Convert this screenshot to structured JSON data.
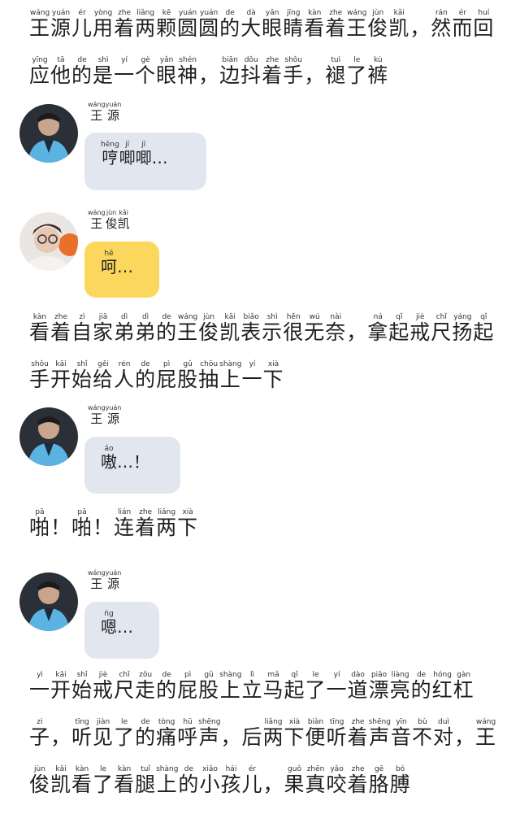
{
  "narration_1": [
    {
      "h": "王",
      "p": "wáng"
    },
    {
      "h": "源",
      "p": "yuán"
    },
    {
      "h": "儿",
      "p": "ér"
    },
    {
      "h": "用",
      "p": "yòng"
    },
    {
      "h": "着",
      "p": "zhe"
    },
    {
      "h": "两",
      "p": "liǎng"
    },
    {
      "h": "颗",
      "p": "kē"
    },
    {
      "h": "圆",
      "p": "yuán"
    },
    {
      "h": "圆",
      "p": "yuán"
    },
    {
      "h": "的",
      "p": "de"
    },
    {
      "h": "大",
      "p": "dà"
    },
    {
      "h": "眼",
      "p": "yǎn"
    },
    {
      "h": "睛",
      "p": "jīng"
    },
    {
      "h": "看",
      "p": "kàn"
    },
    {
      "h": "着",
      "p": "zhe"
    },
    {
      "h": "王",
      "p": "wáng"
    },
    {
      "h": "俊",
      "p": "jùn"
    },
    {
      "h": "凯",
      "p": "kǎi"
    },
    {
      "h": "，",
      "p": ""
    },
    {
      "h": "然",
      "p": "rán"
    },
    {
      "h": "而",
      "p": "ér"
    },
    {
      "h": "回",
      "p": "huí"
    },
    {
      "h": "应",
      "p": "yīng"
    },
    {
      "h": "他",
      "p": "tā"
    },
    {
      "h": "的",
      "p": "de"
    },
    {
      "h": "是",
      "p": "shì"
    },
    {
      "h": "一",
      "p": "yí"
    },
    {
      "h": "个",
      "p": "gè"
    },
    {
      "h": "眼",
      "p": "yǎn"
    },
    {
      "h": "神",
      "p": "shén"
    },
    {
      "h": "，",
      "p": ""
    },
    {
      "h": "边",
      "p": "biān"
    },
    {
      "h": "抖",
      "p": "dǒu"
    },
    {
      "h": "着",
      "p": "zhe"
    },
    {
      "h": "手",
      "p": "shǒu"
    },
    {
      "h": "，",
      "p": ""
    },
    {
      "h": "褪",
      "p": "tuì"
    },
    {
      "h": "了",
      "p": "le"
    },
    {
      "h": "裤",
      "p": "kù"
    }
  ],
  "msg_1": {
    "name": [
      {
        "h": "王",
        "p": "wáng"
      },
      {
        "h": "源",
        "p": "yuán"
      }
    ],
    "text": [
      {
        "h": "哼",
        "p": "hēng"
      },
      {
        "h": "唧",
        "p": "jī"
      },
      {
        "h": "唧",
        "p": "jī"
      },
      {
        "h": "…",
        "p": ""
      }
    ]
  },
  "msg_2": {
    "name": [
      {
        "h": "王",
        "p": "wáng"
      },
      {
        "h": "俊",
        "p": "jùn"
      },
      {
        "h": "凯",
        "p": "kǎi"
      }
    ],
    "text": [
      {
        "h": "呵",
        "p": "hē"
      },
      {
        "h": "…",
        "p": ""
      }
    ]
  },
  "narration_2": [
    {
      "h": "看",
      "p": "kàn"
    },
    {
      "h": "着",
      "p": "zhe"
    },
    {
      "h": "自",
      "p": "zì"
    },
    {
      "h": "家",
      "p": "jiā"
    },
    {
      "h": "弟",
      "p": "dì"
    },
    {
      "h": "弟",
      "p": "dì"
    },
    {
      "h": "的",
      "p": "de"
    },
    {
      "h": "王",
      "p": "wáng"
    },
    {
      "h": "俊",
      "p": "jùn"
    },
    {
      "h": "凯",
      "p": "kǎi"
    },
    {
      "h": "表",
      "p": "biǎo"
    },
    {
      "h": "示",
      "p": "shì"
    },
    {
      "h": "很",
      "p": "hěn"
    },
    {
      "h": "无",
      "p": "wú"
    },
    {
      "h": "奈",
      "p": "nài"
    },
    {
      "h": "，",
      "p": ""
    },
    {
      "h": "拿",
      "p": "ná"
    },
    {
      "h": "起",
      "p": "qǐ"
    },
    {
      "h": "戒",
      "p": "jiè"
    },
    {
      "h": "尺",
      "p": "chǐ"
    },
    {
      "h": "扬",
      "p": "yáng"
    },
    {
      "h": "起",
      "p": "qǐ"
    },
    {
      "h": "手",
      "p": "shǒu"
    },
    {
      "h": "开",
      "p": "kāi"
    },
    {
      "h": "始",
      "p": "shǐ"
    },
    {
      "h": "给",
      "p": "gěi"
    },
    {
      "h": "人",
      "p": "rén"
    },
    {
      "h": "的",
      "p": "de"
    },
    {
      "h": "屁",
      "p": "pì"
    },
    {
      "h": "股",
      "p": "gǔ"
    },
    {
      "h": "抽",
      "p": "chōu"
    },
    {
      "h": "上",
      "p": "shàng"
    },
    {
      "h": "一",
      "p": "yí"
    },
    {
      "h": "下",
      "p": "xià"
    }
  ],
  "msg_3": {
    "name": [
      {
        "h": "王",
        "p": "wáng"
      },
      {
        "h": "源",
        "p": "yuán"
      }
    ],
    "text": [
      {
        "h": "嗷",
        "p": "áo"
      },
      {
        "h": "…！",
        "p": ""
      }
    ]
  },
  "narration_3": [
    {
      "h": "啪",
      "p": "pā"
    },
    {
      "h": "！",
      "p": ""
    },
    {
      "h": "啪",
      "p": "pā"
    },
    {
      "h": "！",
      "p": ""
    },
    {
      "h": "连",
      "p": "lián"
    },
    {
      "h": "着",
      "p": "zhe"
    },
    {
      "h": "两",
      "p": "liǎng"
    },
    {
      "h": "下",
      "p": "xià"
    }
  ],
  "msg_4": {
    "name": [
      {
        "h": "王",
        "p": "wáng"
      },
      {
        "h": "源",
        "p": "yuán"
      }
    ],
    "text": [
      {
        "h": "嗯",
        "p": "ńg"
      },
      {
        "h": "…",
        "p": ""
      }
    ]
  },
  "narration_4": [
    {
      "h": "一",
      "p": "yì"
    },
    {
      "h": "开",
      "p": "kāi"
    },
    {
      "h": "始",
      "p": "shǐ"
    },
    {
      "h": "戒",
      "p": "jiè"
    },
    {
      "h": "尺",
      "p": "chǐ"
    },
    {
      "h": "走",
      "p": "zǒu"
    },
    {
      "h": "的",
      "p": "de"
    },
    {
      "h": "屁",
      "p": "pì"
    },
    {
      "h": "股",
      "p": "gǔ"
    },
    {
      "h": "上",
      "p": "shàng"
    },
    {
      "h": "立",
      "p": "lì"
    },
    {
      "h": "马",
      "p": "mǎ"
    },
    {
      "h": "起",
      "p": "qǐ"
    },
    {
      "h": "了",
      "p": "le"
    },
    {
      "h": "一",
      "p": "yí"
    },
    {
      "h": "道",
      "p": "dào"
    },
    {
      "h": "漂",
      "p": "piāo"
    },
    {
      "h": "亮",
      "p": "liàng"
    },
    {
      "h": "的",
      "p": "de"
    },
    {
      "h": "红",
      "p": "hóng"
    },
    {
      "h": "杠",
      "p": "gàn"
    },
    {
      "h": "子",
      "p": "zi"
    },
    {
      "h": "，",
      "p": ""
    },
    {
      "h": "听",
      "p": "tīng"
    },
    {
      "h": "见",
      "p": "jiàn"
    },
    {
      "h": "了",
      "p": "le"
    },
    {
      "h": "的",
      "p": "de"
    },
    {
      "h": "痛",
      "p": "tòng"
    },
    {
      "h": "呼",
      "p": "hū"
    },
    {
      "h": "声",
      "p": "shēng"
    },
    {
      "h": "，",
      "p": ""
    },
    {
      "h": "后",
      "p": ""
    },
    {
      "h": "两",
      "p": "liǎng"
    },
    {
      "h": "下",
      "p": "xià"
    },
    {
      "h": "便",
      "p": "biàn"
    },
    {
      "h": "听",
      "p": "tīng"
    },
    {
      "h": "着",
      "p": "zhe"
    },
    {
      "h": "声",
      "p": "shēng"
    },
    {
      "h": "音",
      "p": "yīn"
    },
    {
      "h": "不",
      "p": "bù"
    },
    {
      "h": "对",
      "p": "duì"
    },
    {
      "h": "，",
      "p": ""
    },
    {
      "h": "王",
      "p": "wáng"
    },
    {
      "h": "俊",
      "p": "jùn"
    },
    {
      "h": "凯",
      "p": "kǎi"
    },
    {
      "h": "看",
      "p": "kàn"
    },
    {
      "h": "了",
      "p": "le"
    },
    {
      "h": "看",
      "p": "kàn"
    },
    {
      "h": "腿",
      "p": "tuǐ"
    },
    {
      "h": "上",
      "p": "shàng"
    },
    {
      "h": "的",
      "p": "de"
    },
    {
      "h": "小",
      "p": "xiǎo"
    },
    {
      "h": "孩",
      "p": "hái"
    },
    {
      "h": "儿",
      "p": "ér"
    },
    {
      "h": "，",
      "p": ""
    },
    {
      "h": "果",
      "p": "guǒ"
    },
    {
      "h": "真",
      "p": "zhēn"
    },
    {
      "h": "咬",
      "p": "yǎo"
    },
    {
      "h": "着",
      "p": "zhe"
    },
    {
      "h": "胳",
      "p": "gē"
    },
    {
      "h": "膊",
      "p": "bó"
    }
  ],
  "colors": {
    "bubble_gray": "#e1e6ef",
    "bubble_yellow": "#fcd75d"
  }
}
